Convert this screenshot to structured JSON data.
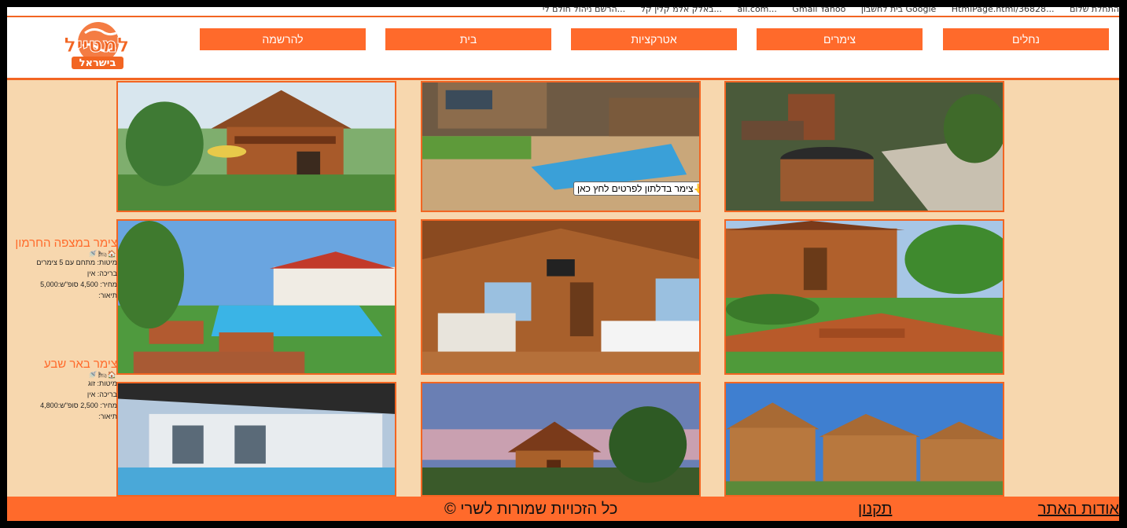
{
  "bookmarks": [
    "התחלת שלום",
    "...36828/HtmlPage.html",
    "Google בית לחשבון",
    "Gmail Yahoo",
    "...ail.com",
    "...באלק אלמ קלין קל",
    "...הרשם ניהול חולם לי"
  ],
  "nav": [
    "נחלים",
    "צימרים",
    "אטרקציות",
    "בית",
    "להרשמה"
  ],
  "logo": {
    "line1": "למטייל",
    "line2": "בישראל"
  },
  "tooltip": "👆צימר בדלתון לפרטים לחץ כאן",
  "listings": [
    {
      "title": "צימר במצפה החרמון",
      "icons": "🏠🛏🚿",
      "features": "מיטות: מתחם עם 5 צימרים",
      "pool": "בריכה: אין",
      "price": "מחיר: 4,500 סופ\"ש:5,000",
      "description": "תיאור:"
    },
    {
      "title": "צימר באר שבע",
      "icons": "🏠🛏🚿",
      "features": "מיטות: זוג",
      "pool": "בריכה: אין",
      "price": "מחיר: 2,500 סופ\"ש:4,800",
      "description": "תיאור:"
    }
  ],
  "footer": {
    "about": "אודות האתר",
    "terms": "תקנון",
    "copyright": "כל הזכויות שמורות לשרי ©"
  },
  "colors": {
    "accent": "#ff6a2b",
    "background": "#f7d7ae"
  }
}
